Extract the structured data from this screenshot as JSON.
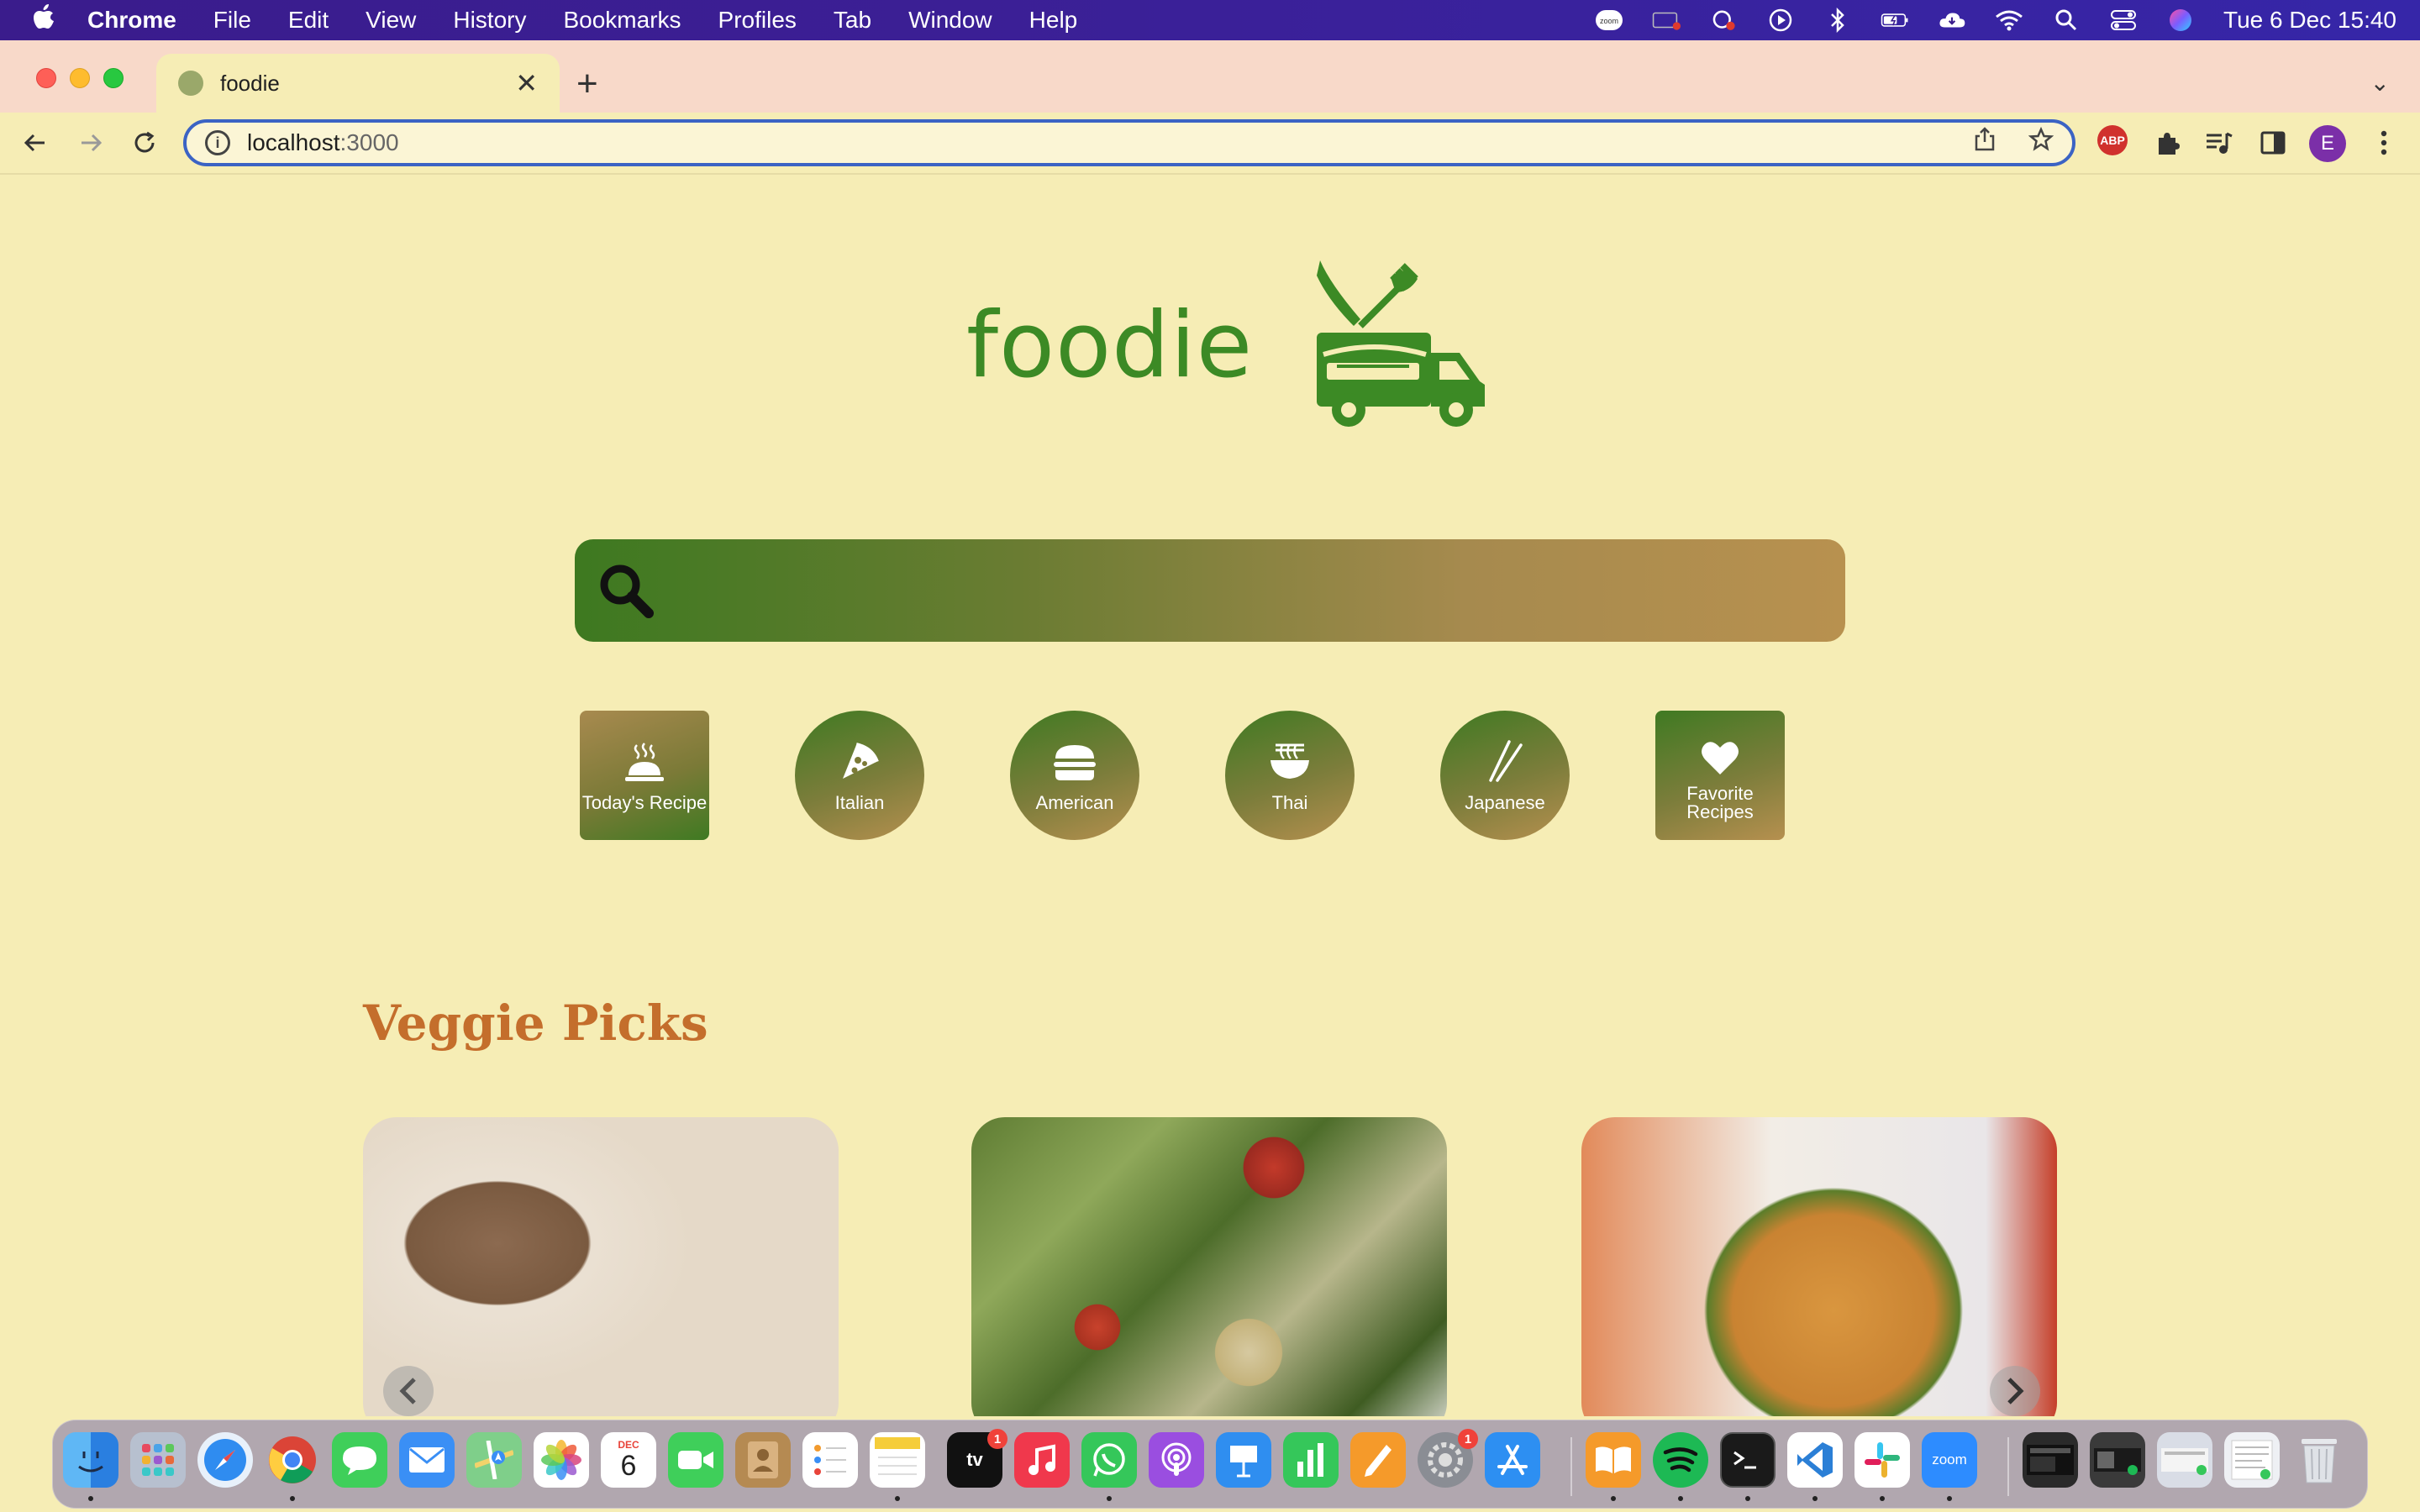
{
  "menubar": {
    "app": "Chrome",
    "items": [
      "File",
      "Edit",
      "View",
      "History",
      "Bookmarks",
      "Profiles",
      "Tab",
      "Window",
      "Help"
    ],
    "status_icons": [
      "zoom-icon",
      "screen-record-icon",
      "creative-cloud-icon",
      "play-icon",
      "bluetooth-icon",
      "battery-icon",
      "cloud-icon",
      "wifi-icon",
      "search-icon",
      "control-center-icon",
      "siri-icon"
    ],
    "zoom_label": "zoom",
    "clock": "Tue 6 Dec  15:40"
  },
  "browser": {
    "tab_title": "foodie",
    "new_tab": "+",
    "url_host": "localhost",
    "url_port": ":3000",
    "profile_initial": "E",
    "abp_label": "ABP"
  },
  "page": {
    "brand": "foodie",
    "search": {
      "value": "",
      "placeholder": ""
    },
    "categories": [
      {
        "label": "Today's Recipe",
        "icon": "cloche-icon"
      },
      {
        "label": "Italian",
        "icon": "pizza-icon"
      },
      {
        "label": "American",
        "icon": "burger-icon"
      },
      {
        "label": "Thai",
        "icon": "noodle-bowl-icon"
      },
      {
        "label": "Japanese",
        "icon": "chopsticks-icon"
      },
      {
        "label": "Favorite Recipes",
        "icon": "heart-icon"
      }
    ],
    "section_title": "Veggie Picks",
    "cards": [
      {
        "image": "lentil-soup-bowls"
      },
      {
        "image": "kale-quinoa-salad"
      },
      {
        "image": "hummus-bowl"
      }
    ]
  },
  "dock": {
    "apps": [
      "Finder",
      "Launchpad",
      "Safari",
      "Chrome",
      "Messages",
      "Mail",
      "Maps",
      "Photos",
      "Calendar",
      "FaceTime",
      "Contacts",
      "Reminders",
      "Notes",
      "Apple TV",
      "Music",
      "WhatsApp",
      "Podcasts",
      "Keynote",
      "Numbers",
      "Pages",
      "System Preferences",
      "App Store",
      "Books",
      "Spotify",
      "Terminal",
      "VS Code",
      "Slack",
      "Zoom"
    ],
    "calendar_month": "DEC",
    "calendar_day": "6",
    "tv_badge": "1",
    "settings_badge": "1",
    "zoom_label": "zoom",
    "tv_label": "tv"
  }
}
